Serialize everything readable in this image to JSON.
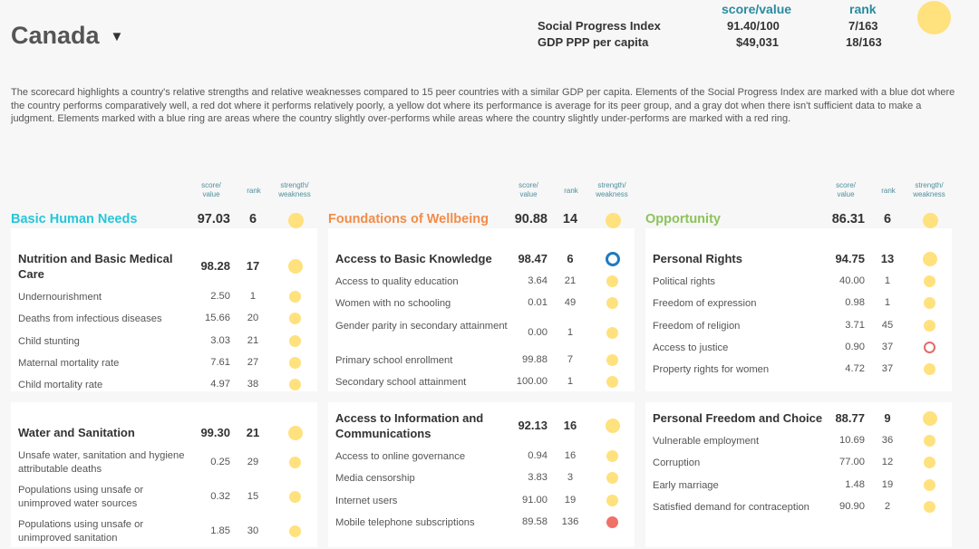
{
  "colors": {
    "yellow": "#ffe17d",
    "blue_ring": "#1f7bbf",
    "red": "#f07167",
    "red_ring": "#e06d66",
    "teal": "#26c6da",
    "orange": "#f28c4a",
    "green": "#8cc35a"
  },
  "header": {
    "country": "Canada",
    "country_dropdown_icon": "caret-down-icon",
    "score_head": "score/value",
    "rank_head": "rank",
    "spi_label": "Social Progress Index",
    "spi_value": "91.40/100",
    "spi_rank": "7/163",
    "gdp_label": "GDP PPP per capita",
    "gdp_value": "$49,031",
    "gdp_rank": "18/163"
  },
  "description": "The scorecard highlights a country's relative strengths and relative weaknesses compared to 15 peer countries with a similar GDP per capita. Elements of the Social Progress Index are marked with a blue dot where the country performs comparatively well, a red dot where it performs relatively poorly, a yellow dot where its performance is average for its peer group, and a gray dot when there isn't sufficient data to make a judgment. Elements marked with a blue ring are areas where the country slightly over-performs while areas where the country slightly under-performs are marked with a red ring.",
  "col_labels": {
    "score": "score/\nvalue",
    "rank": "rank",
    "sw": "strength/\nweakness"
  },
  "columns": [
    {
      "title": "Basic Human Needs",
      "score": "97.03",
      "rank": "6",
      "status": "average",
      "sections": [
        {
          "title": "Nutrition and Basic Medical Care",
          "score": "98.28",
          "rank": "17",
          "status": "average",
          "rows": [
            {
              "label": "Undernourishment",
              "value": "2.50",
              "rank": "1",
              "status": "average"
            },
            {
              "label": "Deaths from infectious diseases",
              "value": "15.66",
              "rank": "20",
              "status": "average"
            },
            {
              "label": "Child stunting",
              "value": "3.03",
              "rank": "21",
              "status": "average"
            },
            {
              "label": "Maternal mortality rate",
              "value": "7.61",
              "rank": "27",
              "status": "average"
            },
            {
              "label": "Child mortality rate",
              "value": "4.97",
              "rank": "38",
              "status": "average"
            }
          ]
        },
        {
          "title": "Water and Sanitation",
          "score": "99.30",
          "rank": "21",
          "status": "average",
          "rows": [
            {
              "label": "Unsafe water, sanitation and hygiene attributable deaths",
              "value": "0.25",
              "rank": "29",
              "status": "average"
            },
            {
              "label": "Populations using unsafe or unimproved water sources",
              "value": "0.32",
              "rank": "15",
              "status": "average"
            },
            {
              "label": "Populations using unsafe or unimproved sanitation",
              "value": "1.85",
              "rank": "30",
              "status": "average"
            }
          ]
        }
      ]
    },
    {
      "title": "Foundations of Wellbeing",
      "score": "90.88",
      "rank": "14",
      "status": "average",
      "sections": [
        {
          "title": "Access to Basic Knowledge",
          "score": "98.47",
          "rank": "6",
          "status": "over",
          "rows": [
            {
              "label": "Access to quality education",
              "value": "3.64",
              "rank": "21",
              "status": "average"
            },
            {
              "label": "Women with no schooling",
              "value": "0.01",
              "rank": "49",
              "status": "average"
            },
            {
              "label": "Gender parity in secondary attainment",
              "value": "0.00",
              "rank": "1",
              "status": "average"
            },
            {
              "label": "Primary school enrollment",
              "value": "99.88",
              "rank": "7",
              "status": "average"
            },
            {
              "label": "Secondary school attainment",
              "value": "100.00",
              "rank": "1",
              "status": "average"
            }
          ]
        },
        {
          "title": "Access to Information and Communications",
          "score": "92.13",
          "rank": "16",
          "status": "average",
          "rows": [
            {
              "label": "Access to online governance",
              "value": "0.94",
              "rank": "16",
              "status": "average"
            },
            {
              "label": "Media censorship",
              "value": "3.83",
              "rank": "3",
              "status": "average"
            },
            {
              "label": "Internet users",
              "value": "91.00",
              "rank": "19",
              "status": "average"
            },
            {
              "label": "Mobile telephone subscriptions",
              "value": "89.58",
              "rank": "136",
              "status": "weak"
            }
          ]
        }
      ]
    },
    {
      "title": "Opportunity",
      "score": "86.31",
      "rank": "6",
      "status": "average",
      "sections": [
        {
          "title": "Personal Rights",
          "score": "94.75",
          "rank": "13",
          "status": "average",
          "rows": [
            {
              "label": "Political rights",
              "value": "40.00",
              "rank": "1",
              "status": "average"
            },
            {
              "label": "Freedom of expression",
              "value": "0.98",
              "rank": "1",
              "status": "average"
            },
            {
              "label": "Freedom of religion",
              "value": "3.71",
              "rank": "45",
              "status": "average"
            },
            {
              "label": "Access to justice",
              "value": "0.90",
              "rank": "37",
              "status": "under"
            },
            {
              "label": "Property rights for women",
              "value": "4.72",
              "rank": "37",
              "status": "average"
            }
          ]
        },
        {
          "title": "Personal Freedom and Choice",
          "score": "88.77",
          "rank": "9",
          "status": "average",
          "rows": [
            {
              "label": "Vulnerable employment",
              "value": "10.69",
              "rank": "36",
              "status": "average"
            },
            {
              "label": "Corruption",
              "value": "77.00",
              "rank": "12",
              "status": "average"
            },
            {
              "label": "Early marriage",
              "value": "1.48",
              "rank": "19",
              "status": "average"
            },
            {
              "label": "Satisfied demand for contraception",
              "value": "90.90",
              "rank": "2",
              "status": "average"
            }
          ]
        }
      ]
    }
  ]
}
